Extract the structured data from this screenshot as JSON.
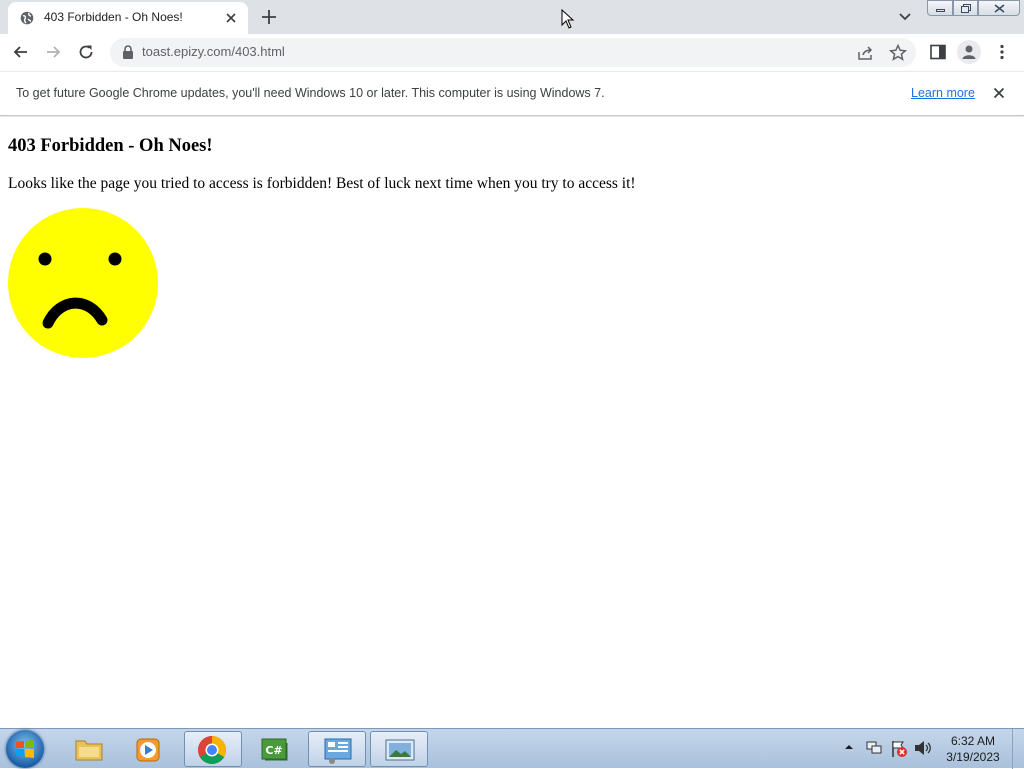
{
  "browser": {
    "tab": {
      "title": "403 Forbidden - Oh Noes!",
      "favicon": "globe-icon"
    },
    "address": {
      "url": "toast.epizy.com/403.html"
    },
    "infobar": {
      "message": "To get future Google Chrome updates, you'll need Windows 10 or later. This computer is using Windows 7.",
      "link_label": "Learn more"
    }
  },
  "page": {
    "heading": "403 Forbidden - Oh Noes!",
    "message": "Looks like the page you tried to access is forbidden! Best of luck next time when you try to access it!",
    "image": "sad-face"
  },
  "taskbar": {
    "apps": [
      "start-orb",
      "file-explorer",
      "media-player",
      "chrome",
      "csharp-editor",
      "control-panel",
      "photo-viewer"
    ],
    "clock": {
      "time": "6:32 AM",
      "date": "3/19/2023"
    }
  },
  "colors": {
    "smiley_yellow": "#ffff00",
    "link_blue": "#1a73e8",
    "tabstrip": "#dee1e6"
  }
}
